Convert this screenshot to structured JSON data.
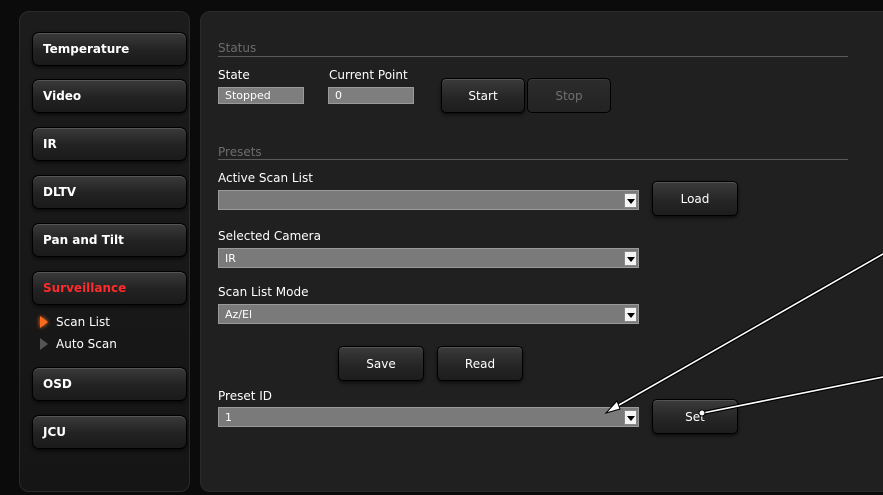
{
  "sidebar": {
    "buttons": [
      {
        "label": "Temperature"
      },
      {
        "label": "Video"
      },
      {
        "label": "IR"
      },
      {
        "label": "DLTV"
      },
      {
        "label": "Pan and Tilt"
      },
      {
        "label": "Surveillance",
        "active": true
      },
      {
        "label": "OSD"
      },
      {
        "label": "JCU"
      }
    ],
    "subitems": [
      {
        "label": "Scan List",
        "selected": true
      },
      {
        "label": "Auto Scan",
        "selected": false
      }
    ]
  },
  "status": {
    "title": "Status",
    "state_label": "State",
    "state_value": "Stopped",
    "current_point_label": "Current Point",
    "current_point_value": "0",
    "start_label": "Start",
    "stop_label": "Stop"
  },
  "presets": {
    "title": "Presets",
    "active_scan_list_label": "Active Scan List",
    "active_scan_list_value": "",
    "load_label": "Load",
    "selected_camera_label": "Selected Camera",
    "selected_camera_value": "IR",
    "scan_list_mode_label": "Scan List Mode",
    "scan_list_mode_value": "Az/El",
    "save_label": "Save",
    "read_label": "Read",
    "preset_id_label": "Preset ID",
    "preset_id_value": "1",
    "set_label": "Set"
  },
  "colors": {
    "active_nav": "#ff2b2b",
    "selected_arrow": "#ff6a1a"
  }
}
